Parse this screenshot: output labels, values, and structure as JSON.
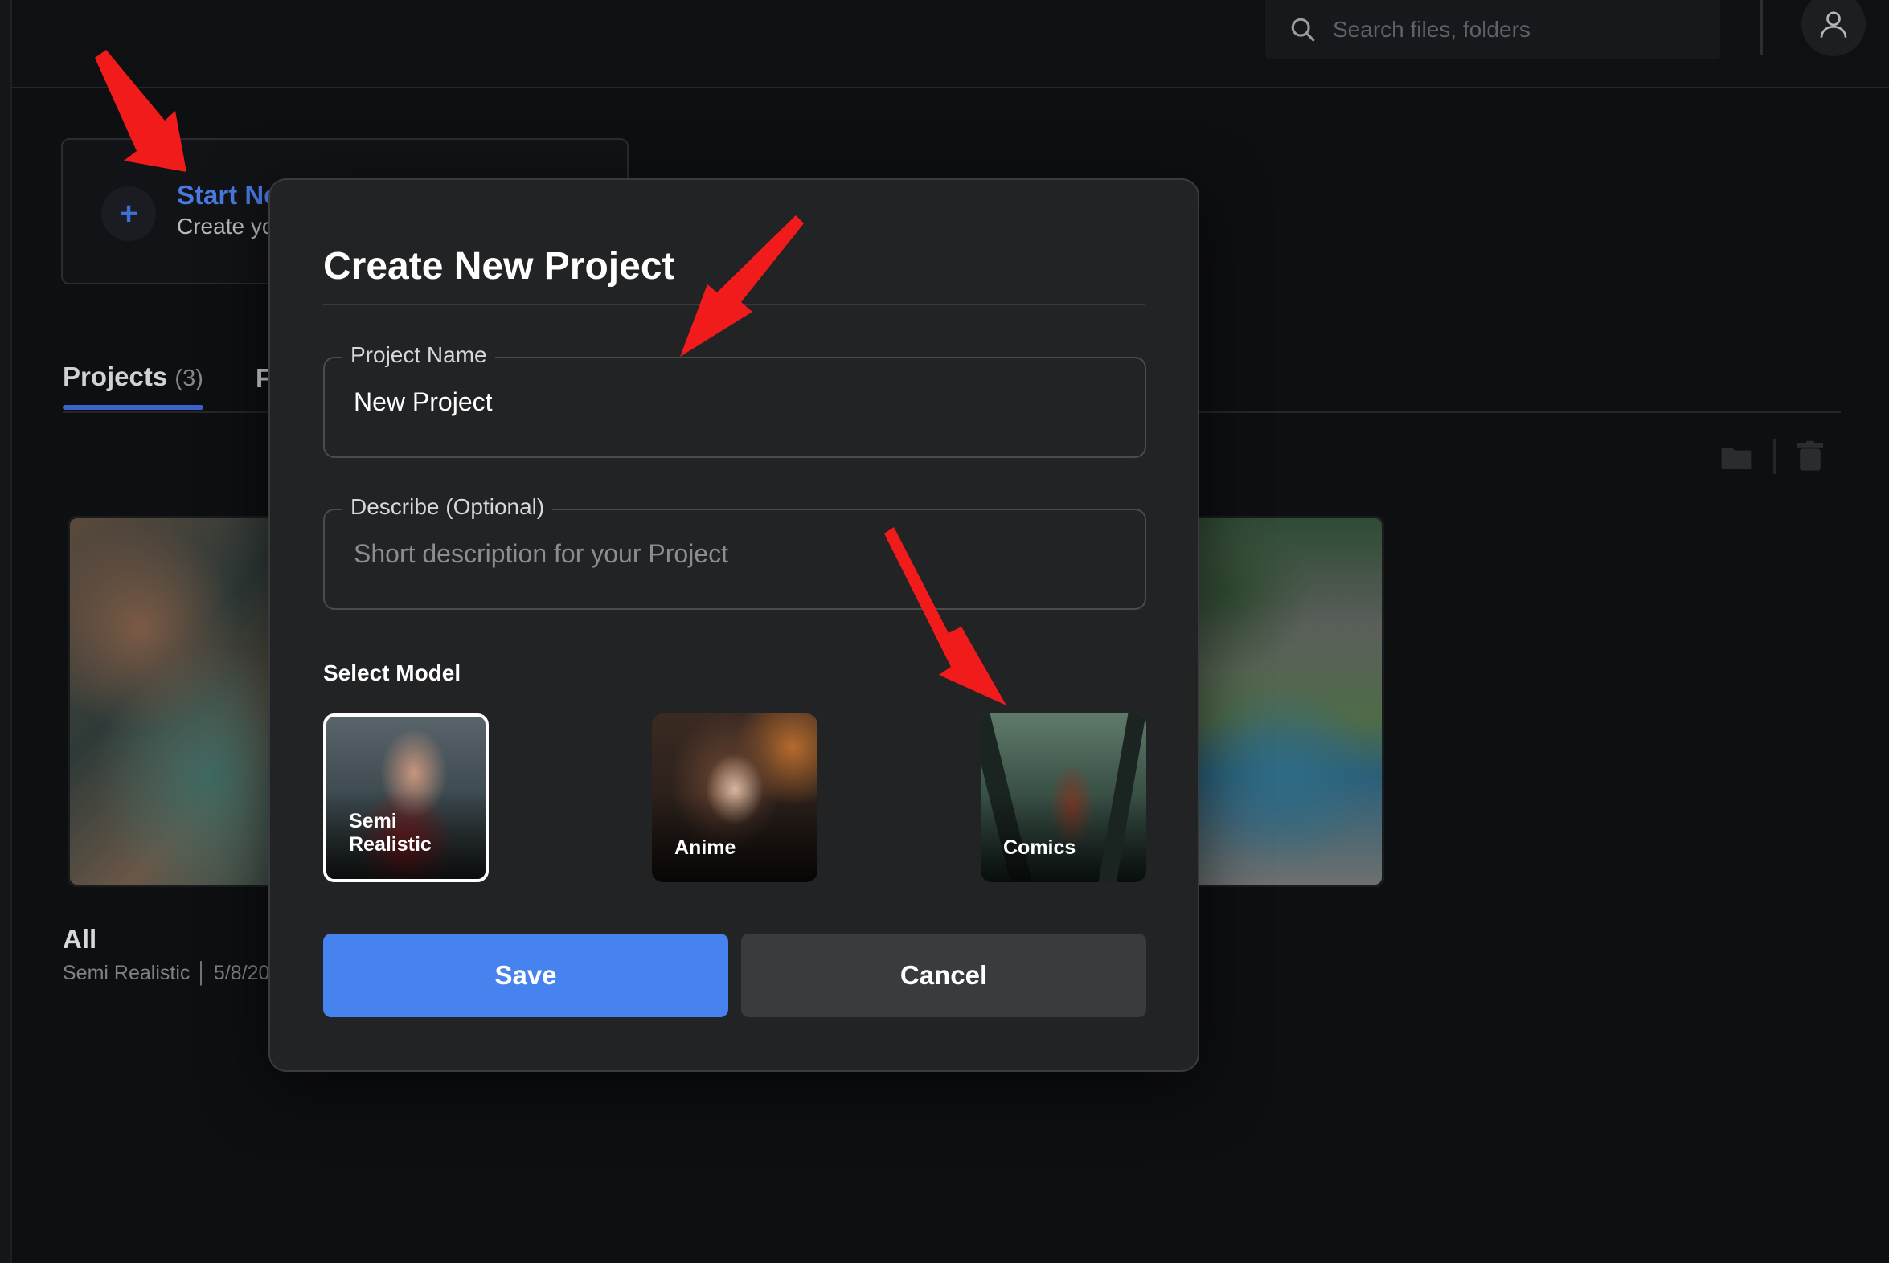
{
  "topbar": {
    "search_placeholder": "Search files, folders"
  },
  "start_card": {
    "title": "Start Ne",
    "subtitle": "Create yo"
  },
  "tabs": {
    "projects_label": "Projects",
    "projects_count": "(3)",
    "other_label": "F"
  },
  "project_card": {
    "title": "All",
    "meta": "Semi Realistic │ 5/8/20"
  },
  "modal": {
    "title": "Create New Project",
    "project_name": {
      "label": "Project Name",
      "value": "New Project"
    },
    "description": {
      "label": "Describe (Optional)",
      "placeholder": "Short description for your Project"
    },
    "select_model_label": "Select Model",
    "models": [
      {
        "name": "Semi Realistic",
        "selected": true
      },
      {
        "name": "Anime",
        "selected": false
      },
      {
        "name": "Comics",
        "selected": false
      }
    ],
    "save_label": "Save",
    "cancel_label": "Cancel"
  },
  "icons": {
    "search": "search-icon",
    "user": "user-icon",
    "plus": "plus-icon",
    "folder": "folder-icon",
    "trash": "trash-icon"
  },
  "colors": {
    "background": "#0e0f11",
    "modal": "#222325",
    "accent_blue": "#4683ee",
    "link_blue": "#4a79e2",
    "annotation_arrow": "#f21b1b"
  }
}
